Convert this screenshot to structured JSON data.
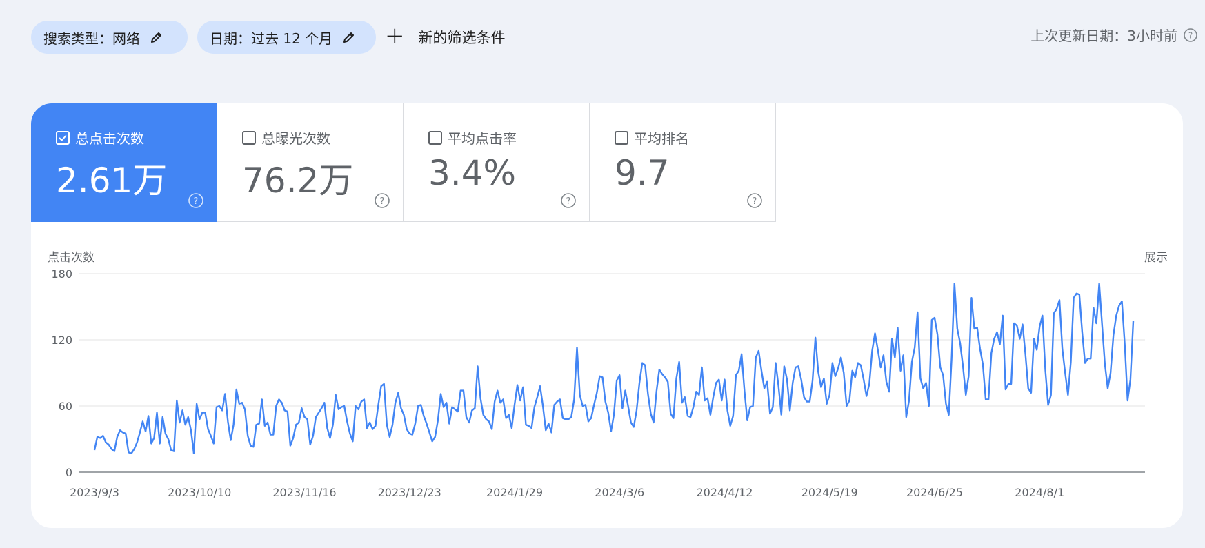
{
  "filters": {
    "search_type": "搜索类型：网络",
    "date": "日期：过去 12 个月",
    "new_filter": "新的筛选条件"
  },
  "updated": "上次更新日期：3小时前",
  "metrics": [
    {
      "label": "总点击次数",
      "value": "2.61万",
      "checked": true
    },
    {
      "label": "总曝光次数",
      "value": "76.2万",
      "checked": false
    },
    {
      "label": "平均点击率",
      "value": "3.4%",
      "checked": false
    },
    {
      "label": "平均排名",
      "value": "9.7",
      "checked": false
    }
  ],
  "chart": {
    "left_axis_title": "点击次数",
    "right_axis_title": "展示"
  },
  "chart_data": {
    "type": "line",
    "title": "",
    "ylabel": "点击次数",
    "ylim": [
      0,
      180
    ],
    "yticks": [
      0,
      60,
      120,
      180
    ],
    "x_tick_labels": [
      "2023/9/3",
      "2023/10/10",
      "2023/11/16",
      "2023/12/23",
      "2024/1/29",
      "2024/3/6",
      "2024/4/12",
      "2024/5/19",
      "2024/6/25",
      "2024/8/1"
    ],
    "x_start": "2023/9/3",
    "x_end": "2024/8/31",
    "line_color": "#4285f4",
    "series": [
      {
        "values": [
          20,
          32,
          31,
          33,
          27,
          25,
          21,
          19,
          32,
          38,
          36,
          35,
          18,
          17,
          21,
          27,
          36,
          46,
          37,
          51,
          26,
          31,
          54,
          26,
          50,
          35,
          30,
          20,
          19,
          65,
          45,
          56,
          43,
          50,
          38,
          17,
          62,
          48,
          54,
          54,
          39,
          33,
          26,
          59,
          60,
          56,
          71,
          46,
          29,
          43,
          75,
          62,
          63,
          57,
          33,
          24,
          23,
          43,
          44,
          66,
          42,
          45,
          34,
          34,
          60,
          66,
          63,
          56,
          55,
          24,
          31,
          43,
          45,
          58,
          50,
          48,
          25,
          33,
          50,
          54,
          58,
          63,
          40,
          31,
          43,
          70,
          57,
          59,
          60,
          46,
          35,
          28,
          60,
          57,
          64,
          66,
          40,
          45,
          39,
          42,
          61,
          78,
          80,
          43,
          32,
          43,
          63,
          72,
          58,
          52,
          39,
          35,
          34,
          44,
          60,
          61,
          51,
          44,
          36,
          28,
          32,
          47,
          71,
          59,
          63,
          44,
          59,
          57,
          55,
          74,
          74,
          50,
          45,
          56,
          58,
          96,
          67,
          52,
          48,
          46,
          39,
          64,
          74,
          63,
          66,
          49,
          52,
          40,
          61,
          79,
          65,
          77,
          43,
          42,
          40,
          59,
          68,
          78,
          60,
          38,
          44,
          36,
          61,
          64,
          66,
          49,
          48,
          48,
          50,
          66,
          113,
          70,
          60,
          61,
          46,
          49,
          61,
          72,
          87,
          86,
          64,
          54,
          37,
          52,
          83,
          88,
          58,
          74,
          60,
          45,
          41,
          56,
          81,
          99,
          97,
          71,
          53,
          45,
          73,
          93,
          89,
          86,
          82,
          53,
          49,
          85,
          100,
          63,
          68,
          51,
          50,
          59,
          73,
          70,
          95,
          65,
          67,
          52,
          68,
          81,
          84,
          65,
          84,
          56,
          42,
          51,
          88,
          92,
          107,
          74,
          47,
          59,
          60,
          104,
          110,
          92,
          76,
          82,
          53,
          59,
          99,
          78,
          52,
          96,
          84,
          56,
          81,
          95,
          96,
          84,
          68,
          64,
          64,
          83,
          122,
          91,
          77,
          85,
          62,
          70,
          99,
          87,
          94,
          104,
          90,
          60,
          65,
          92,
          86,
          99,
          97,
          84,
          69,
          80,
          110,
          126,
          111,
          95,
          106,
          82,
          73,
          121,
          104,
          131,
          92,
          106,
          50,
          65,
          100,
          113,
          145,
          85,
          76,
          81,
          60,
          138,
          140,
          125,
          95,
          88,
          62,
          52,
          103,
          171,
          130,
          117,
          96,
          70,
          87,
          158,
          130,
          131,
          112,
          98,
          66,
          66,
          108,
          121,
          127,
          116,
          142,
          75,
          80,
          80,
          135,
          133,
          121,
          134,
          107,
          76,
          72,
          121,
          111,
          132,
          142,
          93,
          61,
          70,
          144,
          148,
          156,
          112,
          90,
          70,
          100,
          158,
          162,
          161,
          127,
          99,
          103,
          103,
          149,
          135,
          171,
          134,
          98,
          76,
          90,
          124,
          142,
          151,
          155,
          116,
          65,
          84,
          137
        ]
      }
    ]
  }
}
